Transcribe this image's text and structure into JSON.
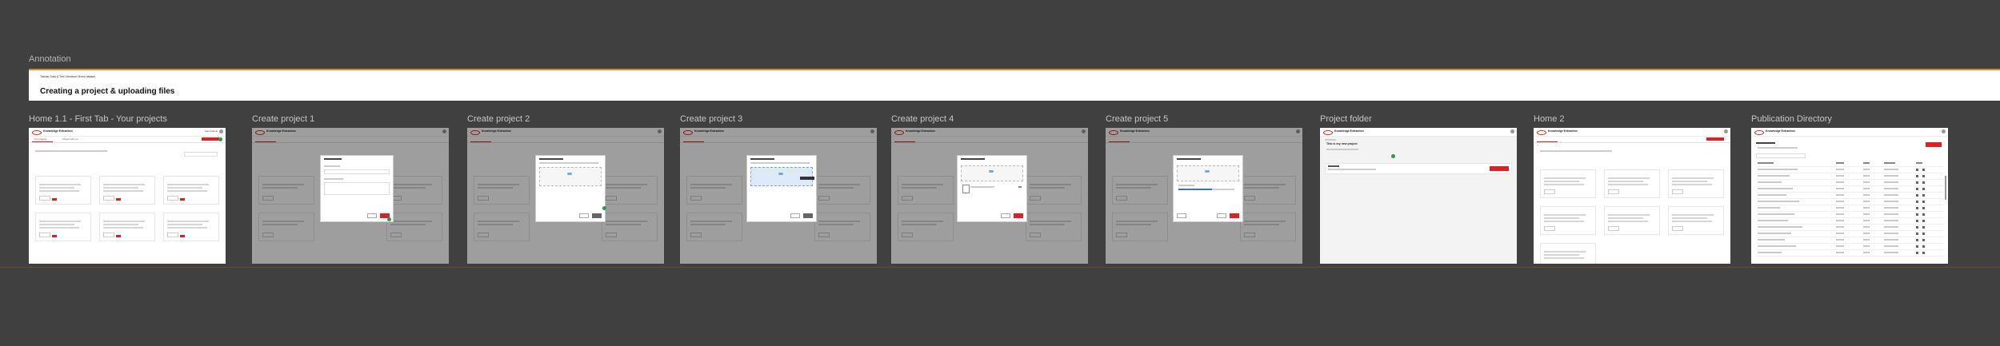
{
  "section": {
    "label": "Annotation"
  },
  "annotation": {
    "small": "Tabular Data & Text Literature Mined dataset",
    "title": "Creating a project & uploading files"
  },
  "app": {
    "name": "Knowledge Extraction",
    "user": "Jean Dubois",
    "tabs": [
      "Your projects",
      "Shared with me"
    ],
    "project_name": "This is my new project"
  },
  "frames": [
    {
      "label": "Home 1.1 - First Tab - Your projects"
    },
    {
      "label": "Create project 1"
    },
    {
      "label": "Create project 2"
    },
    {
      "label": "Create project 3"
    },
    {
      "label": "Create project 4"
    },
    {
      "label": "Create project 5"
    },
    {
      "label": "Project folder"
    },
    {
      "label": "Home 2"
    },
    {
      "label": "Publication Directory"
    }
  ],
  "colors": {
    "accent": "#e02020",
    "bg": "#404040",
    "annotation_line": "#e5832c",
    "success": "#2e9a4a",
    "upload_blue": "#3a74c2"
  }
}
